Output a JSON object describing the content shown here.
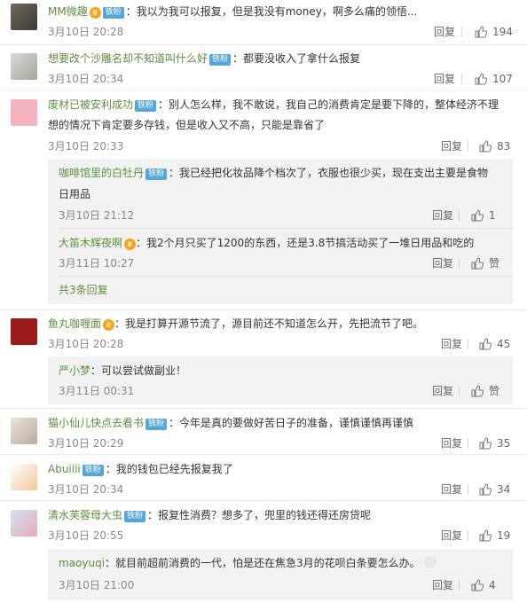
{
  "comments": [
    {
      "user": "MM微趣",
      "badge": "铁粉",
      "text": "：我以为我可以报复，但是我没有money，啊多么痛的领悟...",
      "time": "3月10日 20:28",
      "reply": "回复",
      "likes": "194"
    },
    {
      "user": "想要改个沙雕名却不知道叫什么好",
      "badge": "铁粉",
      "text": "：都要没收入了拿什么报复",
      "time": "3月10日 20:34",
      "reply": "回复",
      "likes": "107"
    },
    {
      "user": "废材已被安利成功",
      "badge": "铁粉",
      "text": "：别人怎么样，我不敢说，我自己的消费肯定是要下降的，整体经济不理",
      "text2": "想的情况下肯定要多存钱，但是收入又不高，只能是靠省了",
      "time": "3月10日 20:33",
      "reply": "回复",
      "likes": "83",
      "subs": [
        {
          "user": "咖啡馆里的白牡丹",
          "badge": "铁粉",
          "text": "：我已经把化妆品降个档次了，衣服也很少买，现在支出主要是食物",
          "text2": "日用品",
          "time": "3月10日 21:12",
          "reply": "回复",
          "likes": "1"
        },
        {
          "user": "大笛木辉夜啊",
          "text": "：我2个月只买了1200的东西，还是3.8节搞活动买了一堆日用品和吃的",
          "time": "3月11日 10:27",
          "reply": "回复",
          "likes": "赞"
        }
      ],
      "more": "共3条回复"
    },
    {
      "user": "鱼丸咖喱面",
      "text": "：我是打算开源节流了，源目前还不知道怎么开，先把流节了吧。",
      "time": "3月10日 20:28",
      "reply": "回复",
      "likes": "45",
      "subs": [
        {
          "user": "严小梦",
          "text": "：可以尝试做副业！",
          "time": "3月11日 00:31",
          "reply": "回复",
          "likes": "赞"
        }
      ]
    },
    {
      "user": "猫小仙儿快点去看书",
      "badge": "铁粉",
      "text": "：今年是真的要做好苦日子的准备，谨慎谨慎再谨慎",
      "time": "3月10日 20:29",
      "reply": "回复",
      "likes": "35"
    },
    {
      "user": "Abuiiii",
      "badge": "铁粉",
      "text": "：我的钱包已经先报复我了",
      "time": "3月10日 20:34",
      "reply": "回复",
      "likes": "34"
    },
    {
      "user": "清水芙蓉母大虫",
      "badge": "铁粉",
      "text": "：报复性消费？想多了，兜里的钱还得还房贷呢",
      "time": "3月10日 20:55",
      "reply": "回复",
      "likes": "19",
      "subs": [
        {
          "user": "maoyuqi",
          "text": "：就目前超前消费的一代，怕是还在焦急3月的花呗白条要怎么办。",
          "time": "3月10日 21:00",
          "reply": "回复",
          "likes": "4"
        }
      ]
    }
  ],
  "colors": {
    "username": "#5e8e3f",
    "badge": "#56a7d9",
    "vip": "#f6a418",
    "subbg": "#f2f2f2"
  }
}
